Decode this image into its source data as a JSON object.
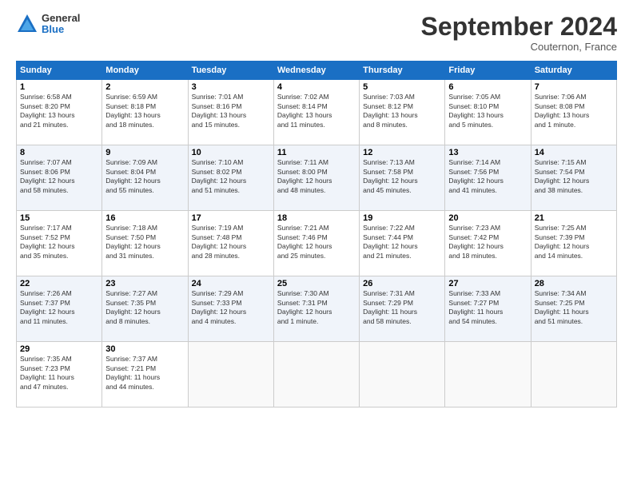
{
  "header": {
    "logo": {
      "general": "General",
      "blue": "Blue"
    },
    "title": "September 2024",
    "location": "Couternon, France"
  },
  "days_of_week": [
    "Sunday",
    "Monday",
    "Tuesday",
    "Wednesday",
    "Thursday",
    "Friday",
    "Saturday"
  ],
  "weeks": [
    [
      {
        "day": "1",
        "info": "Sunrise: 6:58 AM\nSunset: 8:20 PM\nDaylight: 13 hours\nand 21 minutes."
      },
      {
        "day": "2",
        "info": "Sunrise: 6:59 AM\nSunset: 8:18 PM\nDaylight: 13 hours\nand 18 minutes."
      },
      {
        "day": "3",
        "info": "Sunrise: 7:01 AM\nSunset: 8:16 PM\nDaylight: 13 hours\nand 15 minutes."
      },
      {
        "day": "4",
        "info": "Sunrise: 7:02 AM\nSunset: 8:14 PM\nDaylight: 13 hours\nand 11 minutes."
      },
      {
        "day": "5",
        "info": "Sunrise: 7:03 AM\nSunset: 8:12 PM\nDaylight: 13 hours\nand 8 minutes."
      },
      {
        "day": "6",
        "info": "Sunrise: 7:05 AM\nSunset: 8:10 PM\nDaylight: 13 hours\nand 5 minutes."
      },
      {
        "day": "7",
        "info": "Sunrise: 7:06 AM\nSunset: 8:08 PM\nDaylight: 13 hours\nand 1 minute."
      }
    ],
    [
      {
        "day": "8",
        "info": "Sunrise: 7:07 AM\nSunset: 8:06 PM\nDaylight: 12 hours\nand 58 minutes."
      },
      {
        "day": "9",
        "info": "Sunrise: 7:09 AM\nSunset: 8:04 PM\nDaylight: 12 hours\nand 55 minutes."
      },
      {
        "day": "10",
        "info": "Sunrise: 7:10 AM\nSunset: 8:02 PM\nDaylight: 12 hours\nand 51 minutes."
      },
      {
        "day": "11",
        "info": "Sunrise: 7:11 AM\nSunset: 8:00 PM\nDaylight: 12 hours\nand 48 minutes."
      },
      {
        "day": "12",
        "info": "Sunrise: 7:13 AM\nSunset: 7:58 PM\nDaylight: 12 hours\nand 45 minutes."
      },
      {
        "day": "13",
        "info": "Sunrise: 7:14 AM\nSunset: 7:56 PM\nDaylight: 12 hours\nand 41 minutes."
      },
      {
        "day": "14",
        "info": "Sunrise: 7:15 AM\nSunset: 7:54 PM\nDaylight: 12 hours\nand 38 minutes."
      }
    ],
    [
      {
        "day": "15",
        "info": "Sunrise: 7:17 AM\nSunset: 7:52 PM\nDaylight: 12 hours\nand 35 minutes."
      },
      {
        "day": "16",
        "info": "Sunrise: 7:18 AM\nSunset: 7:50 PM\nDaylight: 12 hours\nand 31 minutes."
      },
      {
        "day": "17",
        "info": "Sunrise: 7:19 AM\nSunset: 7:48 PM\nDaylight: 12 hours\nand 28 minutes."
      },
      {
        "day": "18",
        "info": "Sunrise: 7:21 AM\nSunset: 7:46 PM\nDaylight: 12 hours\nand 25 minutes."
      },
      {
        "day": "19",
        "info": "Sunrise: 7:22 AM\nSunset: 7:44 PM\nDaylight: 12 hours\nand 21 minutes."
      },
      {
        "day": "20",
        "info": "Sunrise: 7:23 AM\nSunset: 7:42 PM\nDaylight: 12 hours\nand 18 minutes."
      },
      {
        "day": "21",
        "info": "Sunrise: 7:25 AM\nSunset: 7:39 PM\nDaylight: 12 hours\nand 14 minutes."
      }
    ],
    [
      {
        "day": "22",
        "info": "Sunrise: 7:26 AM\nSunset: 7:37 PM\nDaylight: 12 hours\nand 11 minutes."
      },
      {
        "day": "23",
        "info": "Sunrise: 7:27 AM\nSunset: 7:35 PM\nDaylight: 12 hours\nand 8 minutes."
      },
      {
        "day": "24",
        "info": "Sunrise: 7:29 AM\nSunset: 7:33 PM\nDaylight: 12 hours\nand 4 minutes."
      },
      {
        "day": "25",
        "info": "Sunrise: 7:30 AM\nSunset: 7:31 PM\nDaylight: 12 hours\nand 1 minute."
      },
      {
        "day": "26",
        "info": "Sunrise: 7:31 AM\nSunset: 7:29 PM\nDaylight: 11 hours\nand 58 minutes."
      },
      {
        "day": "27",
        "info": "Sunrise: 7:33 AM\nSunset: 7:27 PM\nDaylight: 11 hours\nand 54 minutes."
      },
      {
        "day": "28",
        "info": "Sunrise: 7:34 AM\nSunset: 7:25 PM\nDaylight: 11 hours\nand 51 minutes."
      }
    ],
    [
      {
        "day": "29",
        "info": "Sunrise: 7:35 AM\nSunset: 7:23 PM\nDaylight: 11 hours\nand 47 minutes."
      },
      {
        "day": "30",
        "info": "Sunrise: 7:37 AM\nSunset: 7:21 PM\nDaylight: 11 hours\nand 44 minutes."
      },
      {
        "day": "",
        "info": ""
      },
      {
        "day": "",
        "info": ""
      },
      {
        "day": "",
        "info": ""
      },
      {
        "day": "",
        "info": ""
      },
      {
        "day": "",
        "info": ""
      }
    ]
  ]
}
